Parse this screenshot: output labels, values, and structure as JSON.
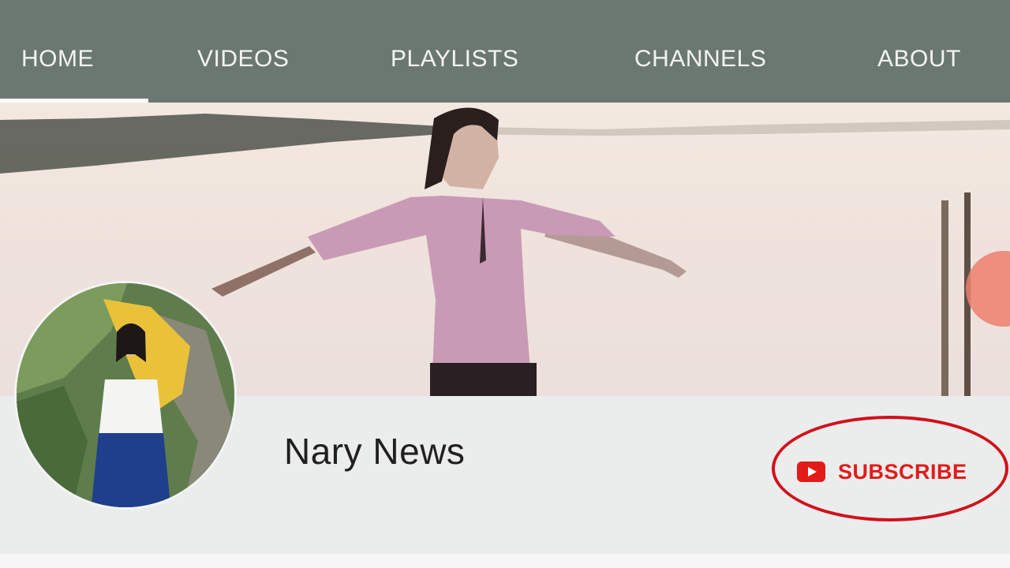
{
  "tabs": [
    {
      "label": "HOME",
      "active": true
    },
    {
      "label": "VIDEOS",
      "active": false
    },
    {
      "label": "PLAYLISTS",
      "active": false
    },
    {
      "label": "CHANNELS",
      "active": false
    },
    {
      "label": "ABOUT",
      "active": false
    }
  ],
  "channel": {
    "name": "Nary News"
  },
  "subscribe": {
    "label": "SUBSCRIBE",
    "icon": "youtube-play-icon"
  },
  "colors": {
    "tab_bar": "#6b7771",
    "subscribe_red": "#e01b1b",
    "annotation_circle": "#d0121b"
  }
}
